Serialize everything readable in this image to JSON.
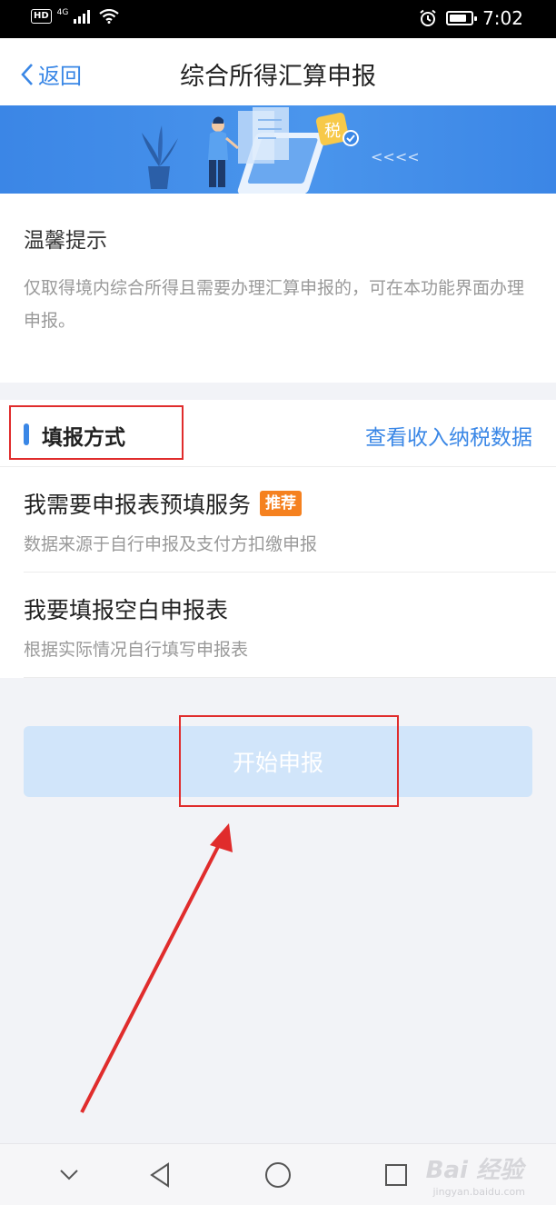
{
  "status_bar": {
    "hd": "HD",
    "network": "4G",
    "time": "7:02",
    "battery_level": 0.8
  },
  "header": {
    "back_label": "返回",
    "title": "综合所得汇算申报"
  },
  "banner": {
    "tax_badge": "税",
    "chevrons": "<<<<"
  },
  "tips": {
    "title": "温馨提示",
    "text": "仅取得境内综合所得且需要办理汇算申报的，可在本功能界面办理申报。"
  },
  "method": {
    "title": "填报方式",
    "link": "查看收入纳税数据",
    "options": [
      {
        "title": "我需要申报表预填服务",
        "badge": "推荐",
        "subtitle": "数据来源于自行申报及支付方扣缴申报"
      },
      {
        "title": "我要填报空白申报表",
        "subtitle": "根据实际情况自行填写申报表"
      }
    ]
  },
  "start_button": "开始申报",
  "watermark": {
    "text": "Bai 经验",
    "url": "jingyan.baidu.com"
  },
  "colors": {
    "accent": "#3a87e6",
    "badge": "#f5811f",
    "annotation": "#e02c2c",
    "button_disabled": "#d1e5fa"
  }
}
